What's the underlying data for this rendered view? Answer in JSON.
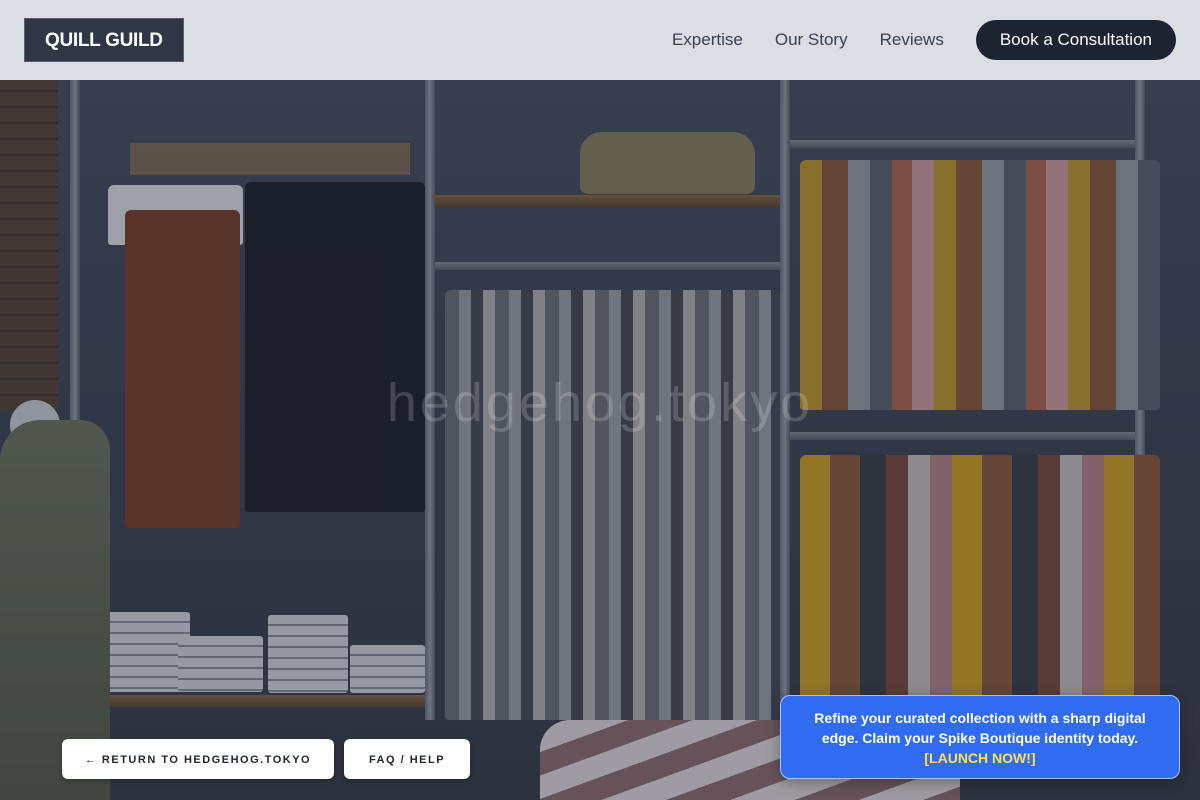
{
  "header": {
    "logo": "QUILL GUILD",
    "nav": [
      {
        "label": "Expertise"
      },
      {
        "label": "Our Story"
      },
      {
        "label": "Reviews"
      }
    ],
    "cta_label": "Book a Consultation"
  },
  "hero": {
    "watermark": "hedgehog.tokyo",
    "image_description_icon": "boutique-clothing-rack-image"
  },
  "footer_buttons": {
    "return_label": "← RETURN TO HEDGEHOG.TOKYO",
    "faq_label": "FAQ / HELP"
  },
  "promo": {
    "text": "Refine your curated collection with a sharp digital edge. Claim your Spike Boutique identity today.",
    "link_label": "[LAUNCH NOW!]"
  },
  "colors": {
    "header_bg": "#e8ebf0",
    "logo_bg": "#2f3645",
    "cta_bg": "#1c2432",
    "promo_bg": "#2f6cf0",
    "promo_link": "#ffe14d"
  }
}
